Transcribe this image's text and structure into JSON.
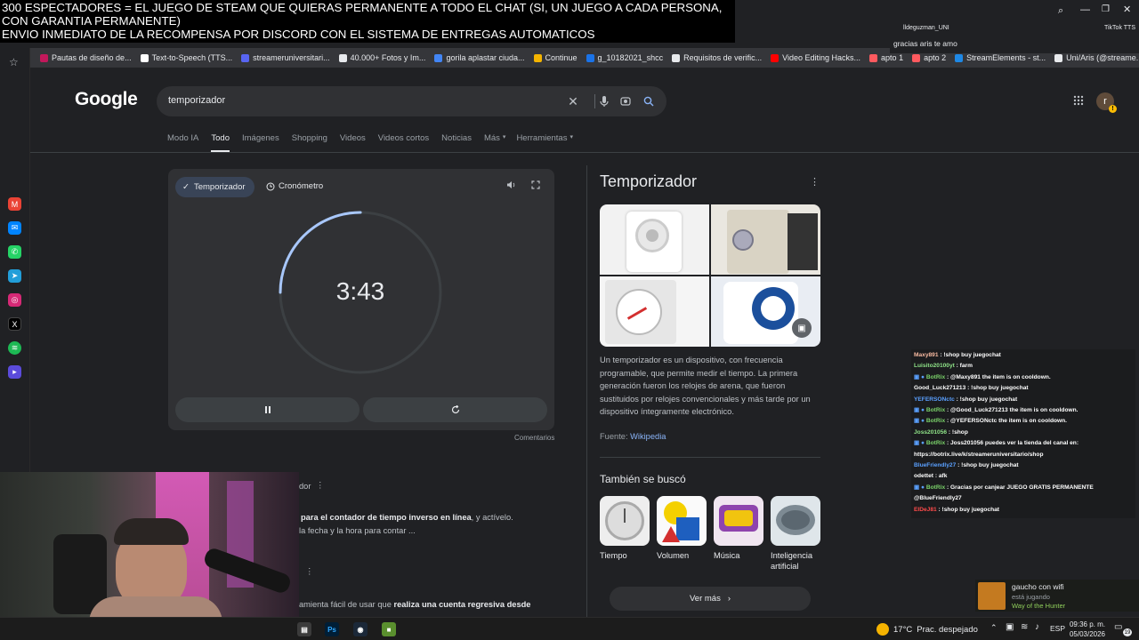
{
  "overlay": {
    "banner_line1": "300 ESPECTADORES = EL JUEGO DE STEAM QUE QUIERAS PERMANENTE A TODO EL CHAT (SI, UN JUEGO A CADA PERSONA,",
    "banner_line2": "CON GARANTIA PERMANENTE)",
    "banner_line3": "ENVIO INMEDIATO DE LA RECOMPENSA POR DISCORD CON EL SISTEMA DE ENTREGAS AUTOMATICOS"
  },
  "tiktok": {
    "user": "lldeguzman_UNI",
    "label": "TikTok TTS",
    "message": "gracias aris te amo"
  },
  "bookmarks": [
    {
      "label": "Pautas de diseño de...",
      "color": "#c2185b"
    },
    {
      "label": "Text-to-Speech (TTS...",
      "color": "#ffffff"
    },
    {
      "label": "streameruniversitari...",
      "color": "#5865f2"
    },
    {
      "label": "40.000+ Fotos y Im...",
      "color": "#e8eaed"
    },
    {
      "label": "gorila aplastar ciuda...",
      "color": "#4285f4"
    },
    {
      "label": "Continue",
      "color": "#f4b400"
    },
    {
      "label": "g_10182021_shcc",
      "color": "#1a73e8"
    },
    {
      "label": "Requisitos de verific...",
      "color": "#e8eaed"
    },
    {
      "label": "Video Editing Hacks...",
      "color": "#ff0000"
    },
    {
      "label": "apto 1",
      "color": "#ff5a5f"
    },
    {
      "label": "apto 2",
      "color": "#ff5a5f"
    },
    {
      "label": "StreamElements - st...",
      "color": "#1e88e5"
    },
    {
      "label": "Uni/Aris (@streame...",
      "color": "#e8eaed"
    }
  ],
  "google": {
    "logo": "Google",
    "query": "temporizador",
    "account_initial": "r",
    "tabs": [
      "Modo IA",
      "Todo",
      "Imágenes",
      "Shopping",
      "Videos",
      "Videos cortos",
      "Noticias",
      "Más",
      "Herramientas"
    ],
    "active_tab": "Todo"
  },
  "timer": {
    "tab_timer": "Temporizador",
    "tab_stopwatch": "Cronómetro",
    "remaining": "3:43",
    "progress_fraction": 0.25,
    "comments": "Comentarios"
  },
  "knowledge": {
    "title": "Temporizador",
    "description": "Un temporizador es un dispositivo, con frecuencia programable, que permite medir el tiempo. La primera generación fueron los relojes de arena, que fueron sustituidos por relojes convencionales y más tarde por un dispositivo íntegramente electrónico.",
    "source_label": "Fuente: ",
    "source_link": "Wikipedia",
    "also_searched": "También se buscó",
    "related": [
      "Tiempo",
      "Volumen",
      "Música",
      "Inteligencia artificial"
    ],
    "see_more": "Ver más"
  },
  "results": {
    "r1_tail": "dor",
    "r1_bold": "para el contador de tiempo inverso en línea",
    "r1_after": ", y actívelo.",
    "r1_line2": "la fecha y la hora para contar ...",
    "r2_pre": "amienta fácil de usar que ",
    "r2_bold": "realiza una cuenta regresiva desde"
  },
  "chat": [
    {
      "user": "Maxy891",
      "ucolor": "#f6b9a0",
      "msg": " : !shop buy juegochat",
      "bot": false
    },
    {
      "user": "Luisito20100yt",
      "ucolor": "#8fe388",
      "msg": " : farm",
      "bot": false
    },
    {
      "user": "BotRix",
      "ucolor": "#7bd36a",
      "msg": " : @Maxy891 the item is on cooldown.",
      "bot": true
    },
    {
      "user": "Good_Luck271213",
      "ucolor": "#ffffff",
      "msg": " : !shop buy juegochat",
      "bot": false
    },
    {
      "user": "YEFERSONctc",
      "ucolor": "#5aa0ff",
      "msg": " : !shop buy juegochat",
      "bot": false
    },
    {
      "user": "BotRix",
      "ucolor": "#7bd36a",
      "msg": " : @Good_Luck271213 the item is on cooldown.",
      "bot": true
    },
    {
      "user": "BotRix",
      "ucolor": "#7bd36a",
      "msg": " : @YEFERSONctc the item is on cooldown.",
      "bot": true
    },
    {
      "user": "Joss201056",
      "ucolor": "#8fe388",
      "msg": " : !shop",
      "bot": false
    },
    {
      "user": "BotRix",
      "ucolor": "#7bd36a",
      "msg": " : Joss201056 puedes ver la tienda del canal en:",
      "bot": true
    },
    {
      "user": "",
      "ucolor": "#ffffff",
      "msg": "https://botrix.live/k/streameruniversitario/shop",
      "bot": false
    },
    {
      "user": "BlueFriendly27",
      "ucolor": "#5aa0ff",
      "msg": " : !shop buy juegochat",
      "bot": false
    },
    {
      "user": "odettet",
      "ucolor": "#ffffff",
      "msg": " : afk",
      "bot": false
    },
    {
      "user": "BotRix",
      "ucolor": "#7bd36a",
      "msg": " : Gracias por canjear JUEGO GRATIS PERMANENTE",
      "bot": true
    },
    {
      "user": "",
      "ucolor": "#ffffff",
      "msg": "@BlueFriendly27",
      "bot": false
    },
    {
      "user": "EIDeJ81",
      "ucolor": "#ff4b4b",
      "msg": " : !shop buy juegochat",
      "bot": false
    }
  ],
  "activity": {
    "name": "gaucho con wifi",
    "status": "está jugando",
    "game": "Way of the Hunter"
  },
  "taskbar": {
    "weather_temp": "17°C",
    "weather_desc": "Prac. despejado",
    "lang": "ESP",
    "time": "09:36 p. m.",
    "date": "05/03/2026",
    "notif_count": "19"
  },
  "colors": {
    "bg": "#202124",
    "surface": "#303134",
    "accent_chip": "#394457",
    "link": "#8ab4f8"
  }
}
